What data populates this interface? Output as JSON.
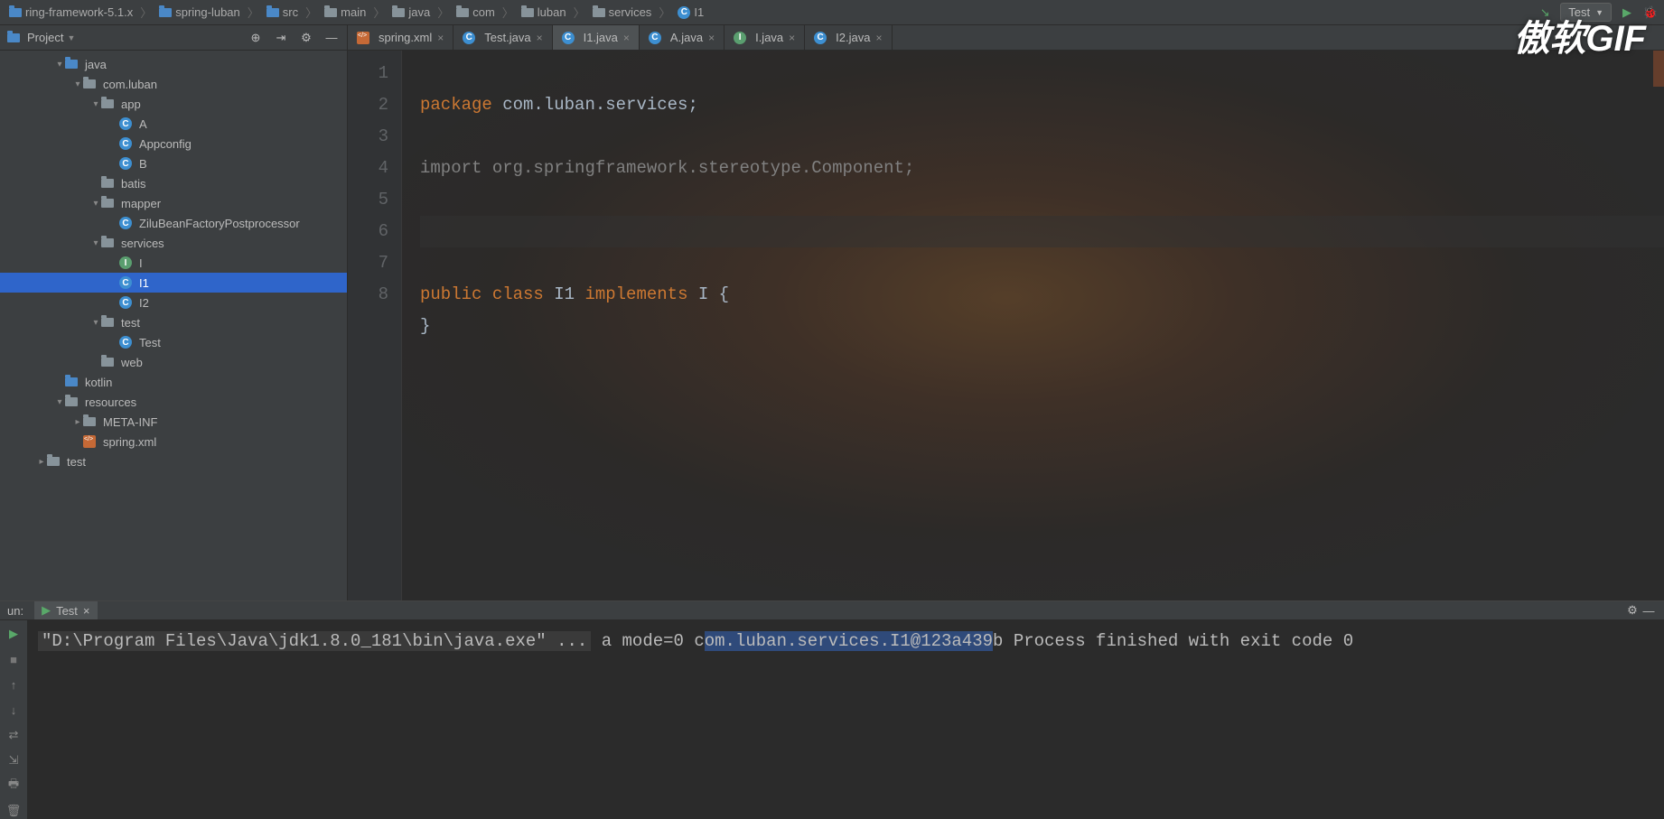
{
  "breadcrumb": [
    {
      "label": "ring-framework-5.1.x",
      "icon": "folder-blue"
    },
    {
      "label": "spring-luban",
      "icon": "folder-blue"
    },
    {
      "label": "src",
      "icon": "folder-blue"
    },
    {
      "label": "main",
      "icon": "folder"
    },
    {
      "label": "java",
      "icon": "folder"
    },
    {
      "label": "com",
      "icon": "folder"
    },
    {
      "label": "luban",
      "icon": "folder"
    },
    {
      "label": "services",
      "icon": "folder"
    },
    {
      "label": "I1",
      "icon": "class-c"
    }
  ],
  "run_config": {
    "label": "Test"
  },
  "project": {
    "title": "Project"
  },
  "tree": [
    {
      "indent": 3,
      "arrow": "▾",
      "icon": "folder-blue",
      "label": "java"
    },
    {
      "indent": 4,
      "arrow": "▾",
      "icon": "folder",
      "label": "com.luban"
    },
    {
      "indent": 5,
      "arrow": "▾",
      "icon": "folder",
      "label": "app"
    },
    {
      "indent": 6,
      "arrow": "",
      "icon": "class-c",
      "label": "A"
    },
    {
      "indent": 6,
      "arrow": "",
      "icon": "class-c",
      "label": "Appconfig"
    },
    {
      "indent": 6,
      "arrow": "",
      "icon": "class-c",
      "label": "B"
    },
    {
      "indent": 5,
      "arrow": "",
      "icon": "folder",
      "label": "batis"
    },
    {
      "indent": 5,
      "arrow": "▾",
      "icon": "folder",
      "label": "mapper"
    },
    {
      "indent": 6,
      "arrow": "",
      "icon": "class-c",
      "label": "ZiluBeanFactoryPostprocessor"
    },
    {
      "indent": 5,
      "arrow": "▾",
      "icon": "folder",
      "label": "services"
    },
    {
      "indent": 6,
      "arrow": "",
      "icon": "class-i",
      "label": "I"
    },
    {
      "indent": 6,
      "arrow": "",
      "icon": "class-c",
      "label": "I1",
      "selected": true
    },
    {
      "indent": 6,
      "arrow": "",
      "icon": "class-c",
      "label": "I2"
    },
    {
      "indent": 5,
      "arrow": "▾",
      "icon": "folder",
      "label": "test"
    },
    {
      "indent": 6,
      "arrow": "",
      "icon": "class-c",
      "label": "Test"
    },
    {
      "indent": 5,
      "arrow": "",
      "icon": "folder",
      "label": "web"
    },
    {
      "indent": 3,
      "arrow": "",
      "icon": "folder-blue",
      "label": "kotlin"
    },
    {
      "indent": 3,
      "arrow": "▾",
      "icon": "folder",
      "label": "resources"
    },
    {
      "indent": 4,
      "arrow": "▸",
      "icon": "folder",
      "label": "META-INF"
    },
    {
      "indent": 4,
      "arrow": "",
      "icon": "xml",
      "label": "spring.xml"
    },
    {
      "indent": 2,
      "arrow": "▸",
      "icon": "folder",
      "label": "test"
    }
  ],
  "tabs": [
    {
      "icon": "xml",
      "label": "spring.xml"
    },
    {
      "icon": "class-c",
      "label": "Test.java"
    },
    {
      "icon": "class-c",
      "label": "I1.java",
      "active": true
    },
    {
      "icon": "class-c",
      "label": "A.java"
    },
    {
      "icon": "class-i",
      "label": "I.java"
    },
    {
      "icon": "class-c",
      "label": "I2.java"
    }
  ],
  "code": {
    "lines": [
      "1",
      "2",
      "3",
      "4",
      "5",
      "6",
      "7",
      "8"
    ],
    "src": {
      "l1_kw": "package",
      "l1_rest": " com.luban.services;",
      "l3_kw": "import",
      "l3_rest": " org.springframework.stereotype.Component;",
      "l6_a": "public class ",
      "l6_b": "I1 ",
      "l6_c": "implements ",
      "l6_d": "I {",
      "l7": "}"
    }
  },
  "run": {
    "label": "un:",
    "tab": "Test",
    "out": {
      "cmd": "\"D:\\Program Files\\Java\\jdk1.8.0_181\\bin\\java.exe\" ...",
      "l2": "a mode=0",
      "l3": "com.luban.services.I1@123a439b",
      "l5": "Process finished with exit code 0"
    }
  },
  "watermark": "傲软GIF"
}
